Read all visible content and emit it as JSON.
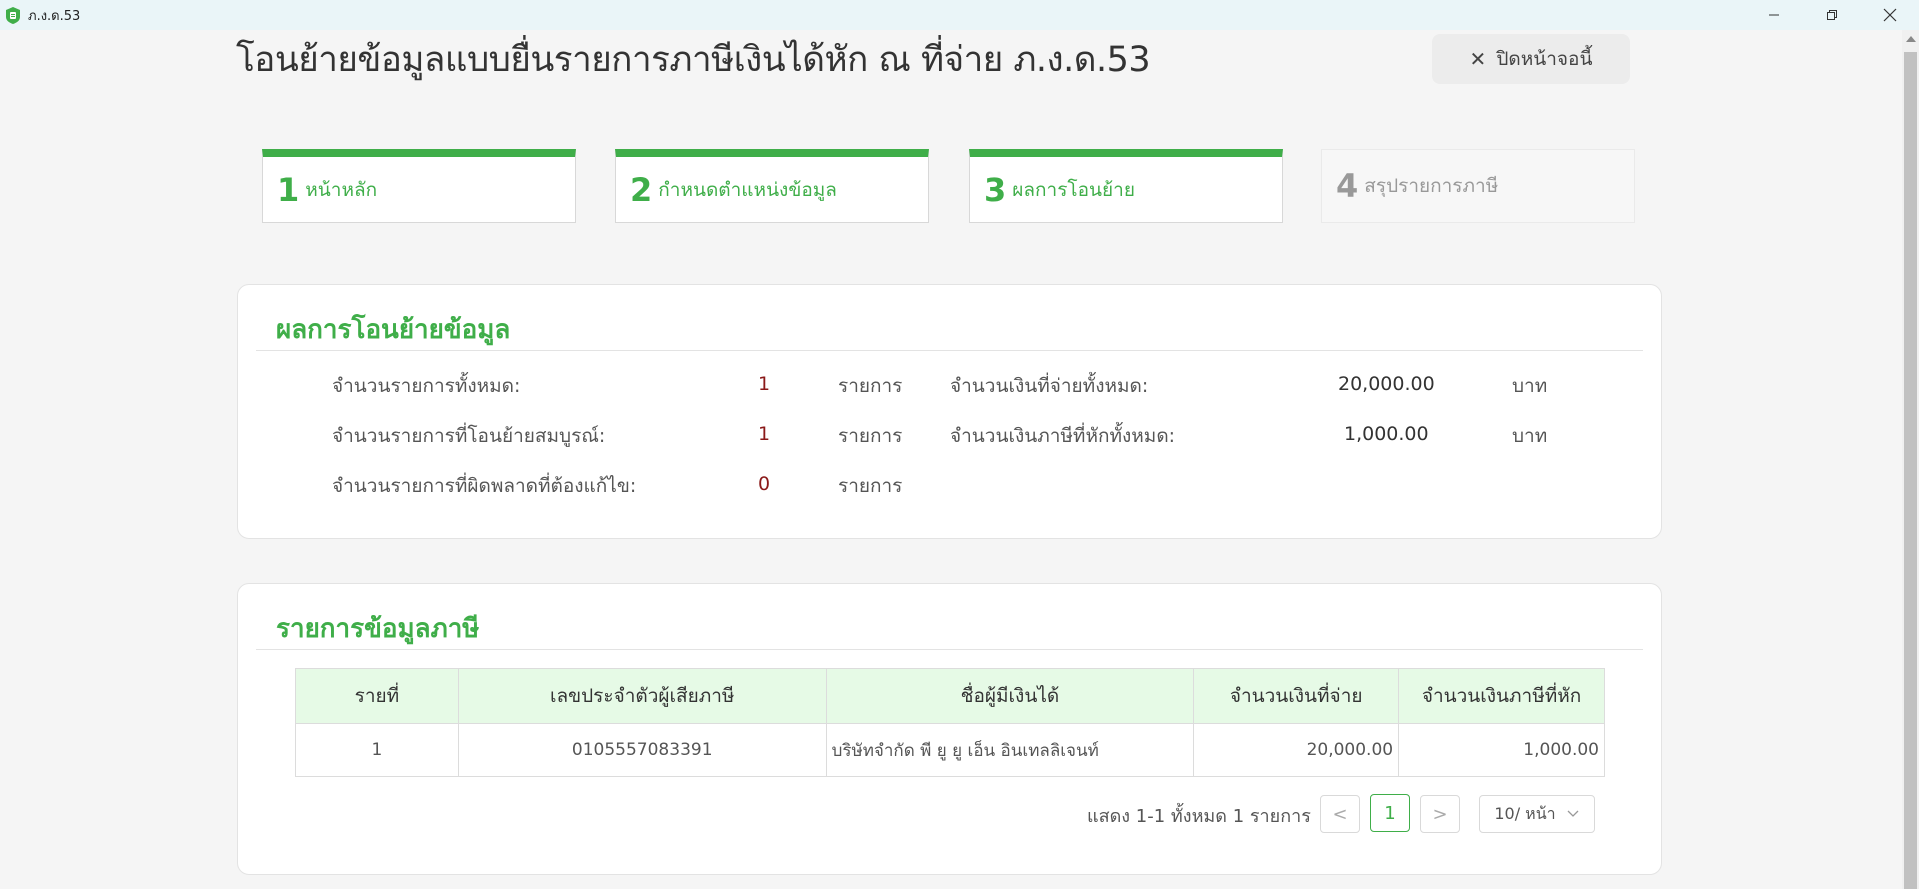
{
  "window": {
    "title": "ภ.ง.ด.53"
  },
  "header": {
    "page_title": "โอนย้ายข้อมูลแบบยื่นรายการภาษีเงินได้หัก ณ ที่จ่าย ภ.ง.ด.53",
    "close_label": "ปิดหน้าจอนี้"
  },
  "steps": [
    {
      "num": "1",
      "label": "หน้าหลัก"
    },
    {
      "num": "2",
      "label": "กำหนดตำแหน่งข้อมูล"
    },
    {
      "num": "3",
      "label": "ผลการโอนย้าย"
    },
    {
      "num": "4",
      "label": "สรุปรายการภาษี"
    }
  ],
  "result": {
    "title": "ผลการโอนย้ายข้อมูล",
    "total_items_label": "จำนวนรายการทั้งหมด:",
    "total_items_value": "1",
    "complete_items_label": "จำนวนรายการที่โอนย้ายสมบูรณ์:",
    "complete_items_value": "1",
    "error_items_label": "จำนวนรายการที่ผิดพลาดที่ต้องแก้ไข:",
    "error_items_value": "0",
    "items_unit": "รายการ",
    "total_paid_label": "จำนวนเงินที่จ่ายทั้งหมด:",
    "total_paid_value": "20,000.00",
    "total_tax_label": "จำนวนเงินภาษีที่หักทั้งหมด:",
    "total_tax_value": "1,000.00",
    "money_unit": "บาท"
  },
  "tax_list": {
    "title": "รายการข้อมูลภาษี",
    "columns": [
      "รายที่",
      "เลขประจำตัวผู้เสียภาษี",
      "ชื่อผู้มีเงินได้",
      "จำนวนเงินที่จ่าย",
      "จำนวนเงินภาษีที่หัก"
    ],
    "rows": [
      {
        "no": "1",
        "tax_id": "0105557083391",
        "name": "บริษัทจำกัด พี ยู ยู เอ็น อินเทลลิเจนท์",
        "paid": "20,000.00",
        "tax": "1,000.00"
      }
    ]
  },
  "pagination": {
    "info": "แสดง 1-1 ทั้งหมด 1 รายการ",
    "prev": "<",
    "current_page": "1",
    "next": ">",
    "page_size": "10/ หน้า"
  },
  "colors": {
    "accent": "#3fae49",
    "value_red": "#8b1a1a",
    "table_header_bg": "#e6fae6"
  }
}
